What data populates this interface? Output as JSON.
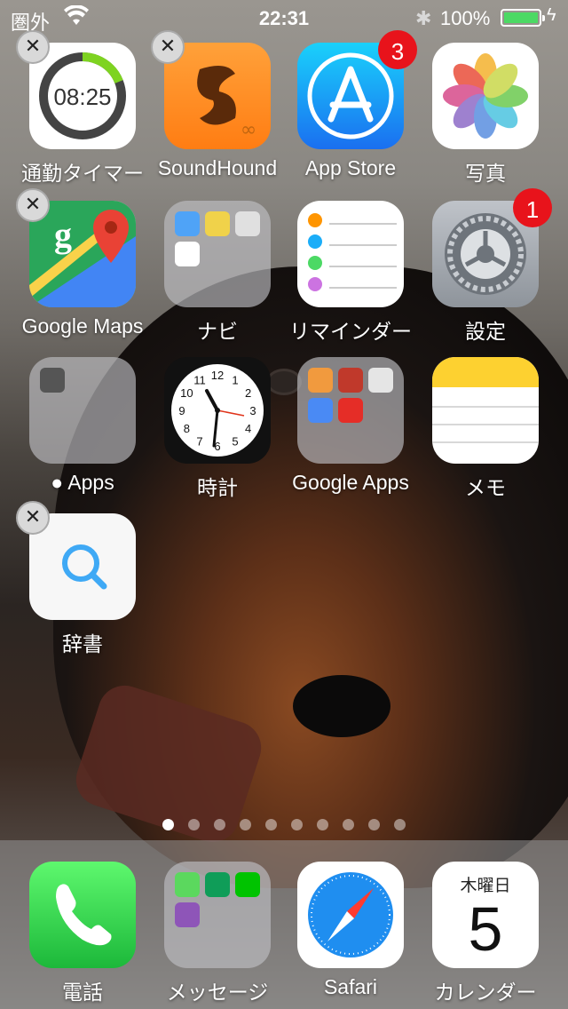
{
  "status_bar": {
    "carrier": "圏外",
    "time": "22:31",
    "battery_percent": "100%",
    "battery_level": 1.0
  },
  "apps": [
    {
      "name": "通勤タイマー",
      "icon": "timer-icon",
      "deletable": true,
      "badge": null,
      "timer_text": "08:25"
    },
    {
      "name": "SoundHound",
      "icon": "soundhound-icon",
      "deletable": true,
      "badge": null
    },
    {
      "name": "App Store",
      "icon": "app-store-icon",
      "deletable": false,
      "badge": "3"
    },
    {
      "name": "写真",
      "icon": "photos-icon",
      "deletable": false,
      "badge": null
    },
    {
      "name": "Google Maps",
      "icon": "google-maps-icon",
      "deletable": true,
      "badge": null
    },
    {
      "name": "ナビ",
      "icon": "folder-icon",
      "deletable": false,
      "badge": null
    },
    {
      "name": "リマインダー",
      "icon": "reminders-icon",
      "deletable": false,
      "badge": null
    },
    {
      "name": "設定",
      "icon": "settings-icon",
      "deletable": false,
      "badge": "1"
    },
    {
      "name": "Apps",
      "icon": "folder-icon",
      "deletable": false,
      "badge": null
    },
    {
      "name": "時計",
      "icon": "clock-icon",
      "deletable": false,
      "badge": null
    },
    {
      "name": "Google Apps",
      "icon": "folder-icon",
      "deletable": false,
      "badge": null
    },
    {
      "name": "メモ",
      "icon": "notes-icon",
      "deletable": false,
      "badge": null
    },
    {
      "name": "辞書",
      "icon": "dictionary-icon",
      "deletable": true,
      "badge": null
    }
  ],
  "page_dots": {
    "count": 10,
    "active": 0
  },
  "dock": [
    {
      "name": "電話",
      "icon": "phone-icon"
    },
    {
      "name": "メッセージ",
      "icon": "folder-icon"
    },
    {
      "name": "Safari",
      "icon": "safari-icon"
    },
    {
      "name": "カレンダー",
      "icon": "calendar-icon",
      "weekday": "木曜日",
      "day": "5"
    }
  ],
  "clock_numbers": [
    "12",
    "1",
    "2",
    "3",
    "4",
    "5",
    "6",
    "7",
    "8",
    "9",
    "10",
    "11"
  ],
  "colors": {
    "badge": "#e8131b",
    "battery": "#4cd964"
  }
}
